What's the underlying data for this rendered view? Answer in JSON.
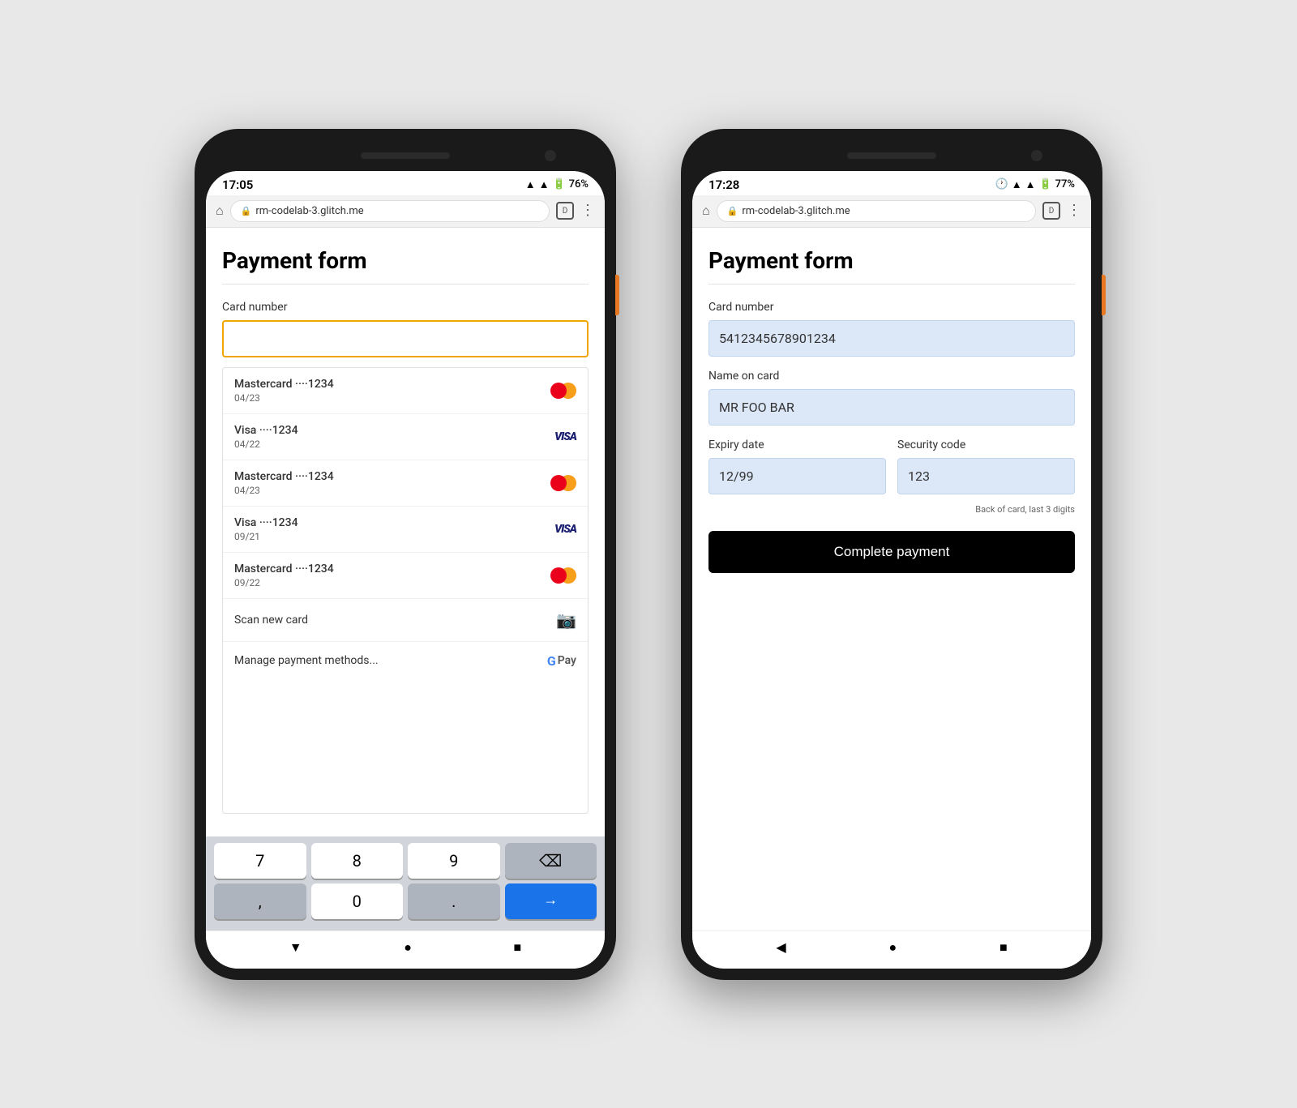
{
  "leftPhone": {
    "statusBar": {
      "time": "17:05",
      "signal": "▲",
      "battery": "76%"
    },
    "browser": {
      "url": "rm-codelab-3.glitch.me"
    },
    "form": {
      "title": "Payment form",
      "cardNumberLabel": "Card number",
      "cardNumberPlaceholder": ""
    },
    "savedCards": [
      {
        "brand": "Mastercard",
        "dots": "····1234",
        "expiry": "04/23",
        "type": "mc"
      },
      {
        "brand": "Visa",
        "dots": "····1234",
        "expiry": "04/22",
        "type": "visa"
      },
      {
        "brand": "Mastercard",
        "dots": "····1234",
        "expiry": "04/23",
        "type": "mc"
      },
      {
        "brand": "Visa",
        "dots": "····1234",
        "expiry": "09/21",
        "type": "visa"
      },
      {
        "brand": "Mastercard",
        "dots": "····1234",
        "expiry": "09/22",
        "type": "mc"
      }
    ],
    "scanLabel": "Scan new card",
    "manageLabel": "Manage payment methods...",
    "keyboard": {
      "rows": [
        [
          "7",
          "8",
          "9",
          "⌫"
        ],
        [
          ",",
          "0",
          ".",
          "→"
        ]
      ]
    }
  },
  "rightPhone": {
    "statusBar": {
      "time": "17:28",
      "battery": "77%"
    },
    "browser": {
      "url": "rm-codelab-3.glitch.me"
    },
    "form": {
      "title": "Payment form",
      "cardNumberLabel": "Card number",
      "cardNumberValue": "5412345678901234",
      "nameLabel": "Name on card",
      "nameValue": "MR FOO BAR",
      "expiryLabel": "Expiry date",
      "expiryValue": "12/99",
      "securityLabel": "Security code",
      "securityValue": "123",
      "securityHelper": "Back of card, last 3 digits",
      "submitLabel": "Complete payment"
    }
  }
}
